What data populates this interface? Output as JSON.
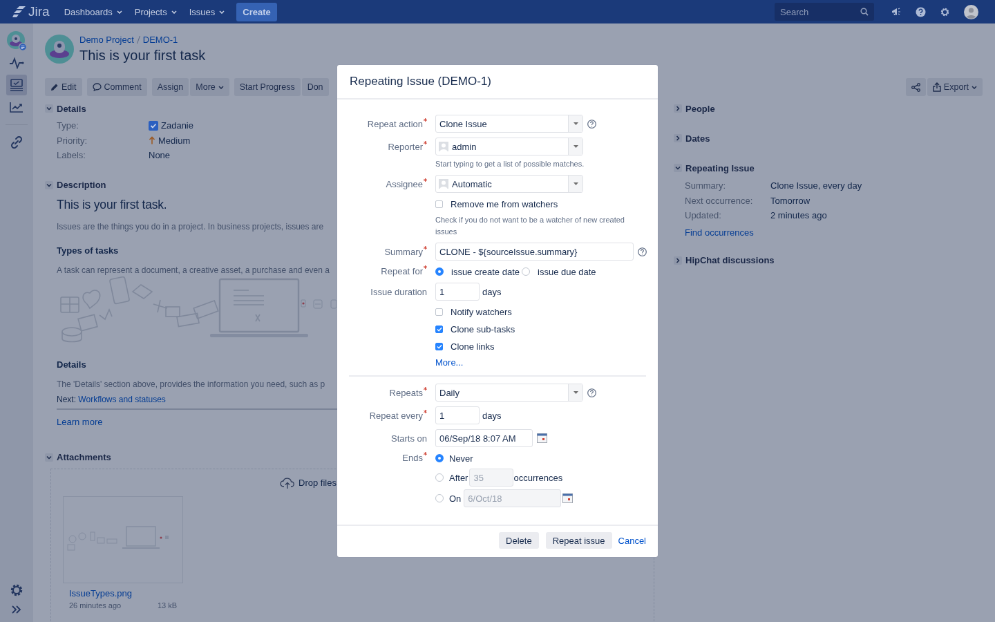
{
  "nav": {
    "logo": "Jira",
    "menus": [
      "Dashboards",
      "Projects",
      "Issues"
    ],
    "create": "Create",
    "search": {
      "placeholder": "Search"
    }
  },
  "sidebar": {
    "items": [
      {
        "kind": "project",
        "selected": false
      },
      {
        "kind": "pulse",
        "selected": false
      },
      {
        "kind": "board",
        "selected": true
      },
      {
        "kind": "chart",
        "selected": false
      },
      {
        "kind": "link",
        "selected": false
      }
    ]
  },
  "issue": {
    "breadcrumbs": [
      "Demo Project",
      "DEMO-1"
    ],
    "title": "This is your first task"
  },
  "toolbar": {
    "left": [
      [
        {
          "label": "Edit",
          "kind": "edit"
        }
      ],
      [
        {
          "label": "Comment",
          "kind": "comment"
        }
      ],
      [
        {
          "label": "Assign",
          "kind": "plain"
        },
        {
          "label": "More",
          "kind": "menu"
        }
      ],
      [
        {
          "label": "Start Progress",
          "kind": "plain"
        },
        {
          "label": "Don",
          "kind": "plain"
        }
      ]
    ],
    "right": [
      {
        "kind": "share"
      },
      {
        "label": "Export",
        "kind": "export"
      }
    ]
  },
  "details": {
    "title": "Details",
    "expanded": true,
    "fields": [
      {
        "label": "Type:",
        "value": "Zadanie",
        "kind": "type"
      },
      {
        "label": "Priority:",
        "value": "Medium",
        "kind": "priority"
      },
      {
        "label": "Labels:",
        "value": "None",
        "kind": "plain"
      }
    ]
  },
  "description": {
    "title": "Description",
    "expanded": true,
    "blocks": [
      {
        "kind": "h1",
        "text": "This is your first task."
      },
      {
        "kind": "p",
        "text": "Issues are the things you do in a project. In business projects, issues are"
      },
      {
        "kind": "h3",
        "text": "Types of tasks"
      },
      {
        "kind": "p",
        "text": "A task can represent a document, a creative asset, a purchase and even a"
      },
      {
        "kind": "illustration"
      },
      {
        "kind": "h3",
        "text": "Details"
      },
      {
        "kind": "p",
        "text": "The 'Details' section above, provides the information you need, such as p"
      },
      {
        "kind": "next",
        "label": "Next:",
        "link": "Workflows and statuses"
      },
      {
        "kind": "rule"
      },
      {
        "kind": "link",
        "text": "Learn more"
      }
    ]
  },
  "attachments": {
    "title": "Attachments",
    "expanded": true,
    "drop": "Drop files",
    "files": [
      {
        "name": "IssueTypes.png",
        "age": "26 minutes ago",
        "size": "13 kB"
      }
    ]
  },
  "panels": [
    {
      "title": "People",
      "expanded": false
    },
    {
      "title": "Dates",
      "expanded": false
    },
    {
      "title": "Repeating Issue",
      "expanded": true,
      "fields": [
        {
          "label": "Summary:",
          "value": "Clone Issue, every day"
        },
        {
          "label": "Next occurrence:",
          "value": "Tomorrow"
        },
        {
          "label": "Updated:",
          "value": "2 minutes ago"
        }
      ],
      "link": "Find occurrences"
    },
    {
      "title": "HipChat discussions",
      "expanded": false
    }
  ],
  "modal": {
    "title": "Repeating Issue (DEMO-1)",
    "sections": [
      [
        {
          "kind": "select",
          "label": "Repeat action",
          "required": true,
          "value": "Clone Issue",
          "help": true
        },
        {
          "kind": "user",
          "label": "Reporter",
          "required": true,
          "value": "admin",
          "hint": "Start typing to get a list of possible matches."
        },
        {
          "kind": "user",
          "label": "Assignee",
          "required": true,
          "value": "Automatic"
        },
        {
          "kind": "checkbox",
          "label": "Remove me from watchers",
          "checked": false,
          "hint": "Check if you do not want to be a watcher of new created issues"
        },
        {
          "kind": "text",
          "label": "Summary",
          "required": true,
          "value": "CLONE - ${sourceIssue.summary}",
          "help": true
        },
        {
          "kind": "radios",
          "label": "Repeat for",
          "required": true,
          "options": [
            {
              "label": "issue create date",
              "selected": true
            },
            {
              "label": "issue due date",
              "selected": false
            }
          ]
        },
        {
          "kind": "number",
          "label": "Issue duration",
          "required": false,
          "value": "1",
          "unit": "days"
        },
        {
          "kind": "checkbox",
          "label": "Notify watchers",
          "checked": false
        },
        {
          "kind": "checkbox",
          "label": "Clone sub-tasks",
          "checked": true
        },
        {
          "kind": "checkbox",
          "label": "Clone links",
          "checked": true
        },
        {
          "kind": "link",
          "label": "More..."
        }
      ],
      [
        {
          "kind": "select",
          "label": "Repeats",
          "required": true,
          "value": "Daily",
          "help": true
        },
        {
          "kind": "number",
          "label": "Repeat every",
          "required": true,
          "value": "1",
          "unit": "days"
        },
        {
          "kind": "date",
          "label": "Starts on",
          "required": false,
          "value": "06/Sep/18 8:07 AM"
        },
        {
          "kind": "ends",
          "label": "Ends",
          "required": true,
          "options": [
            {
              "kind": "plain",
              "label": "Never",
              "selected": true
            },
            {
              "kind": "count",
              "label": "After",
              "selected": false,
              "value": "35",
              "unit": "occurrences",
              "disabled": true
            },
            {
              "kind": "date",
              "label": "On",
              "selected": false,
              "value": "6/Oct/18",
              "disabled": true
            }
          ]
        }
      ]
    ],
    "buttons": [
      {
        "label": "Delete",
        "kind": "button"
      },
      {
        "label": "Repeat issue",
        "kind": "button"
      },
      {
        "label": "Cancel",
        "kind": "link"
      }
    ]
  }
}
